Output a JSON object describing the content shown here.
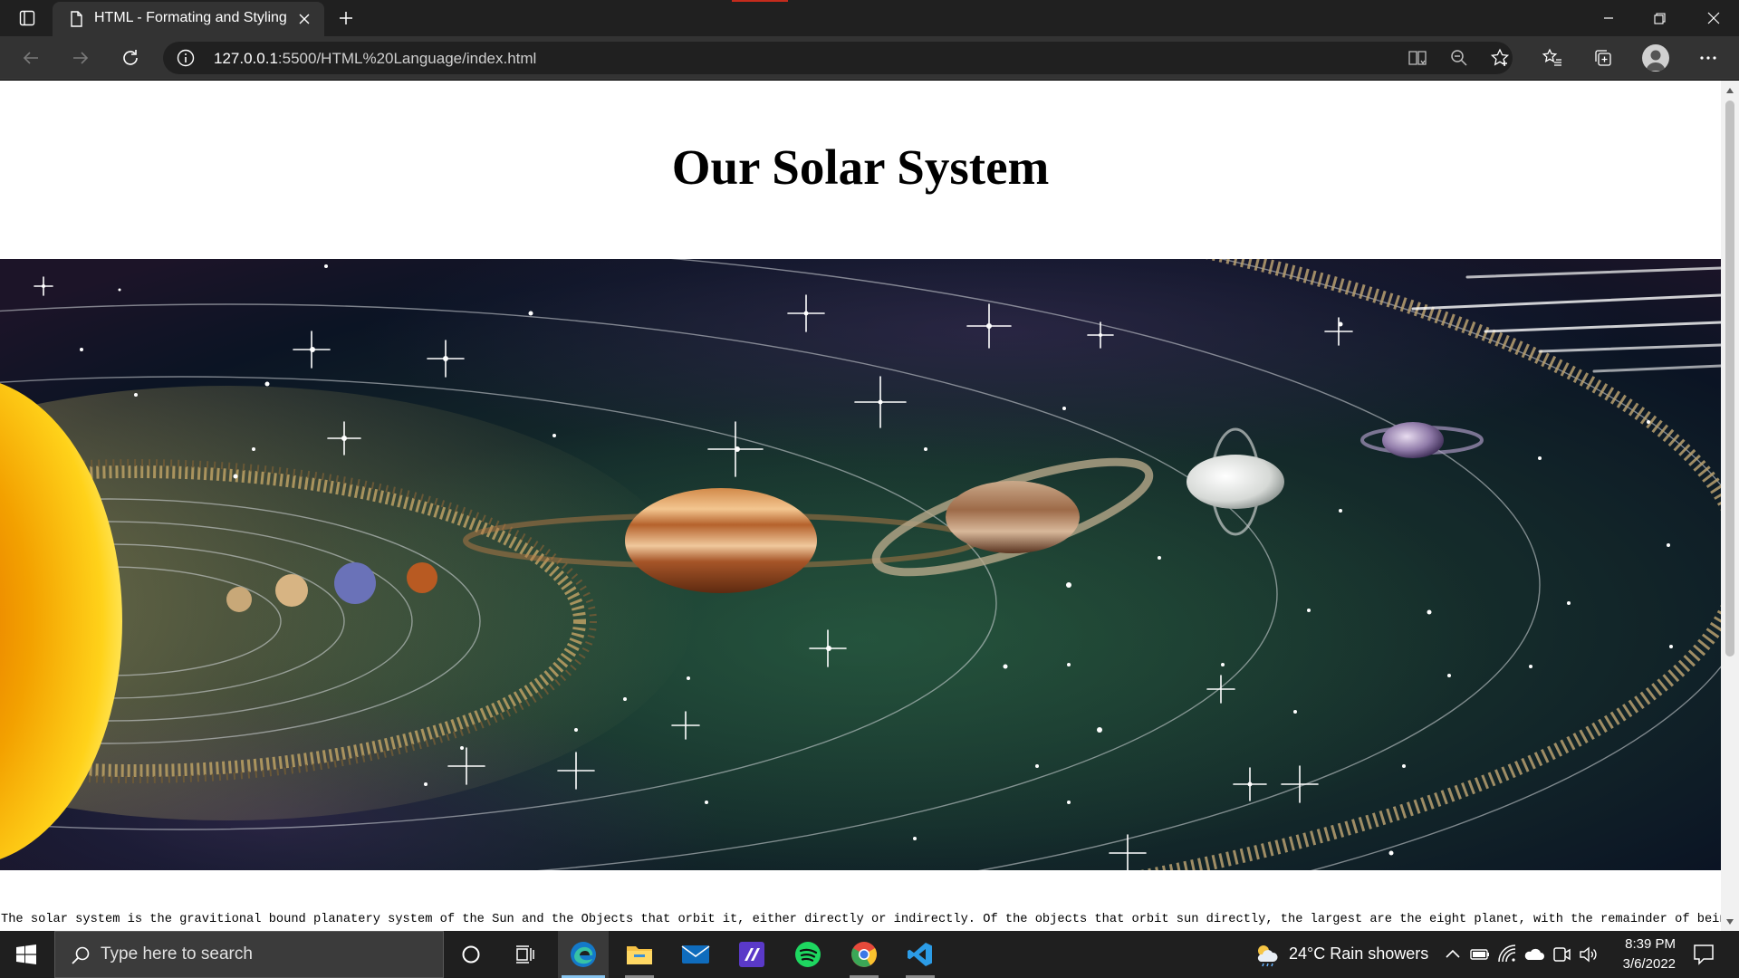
{
  "browser": {
    "tab": {
      "title": "HTML - Formating and Styling"
    },
    "address": {
      "host": "127.0.0.1",
      "path": ":5500/HTML%20Language/index.html"
    },
    "accent_color": "#c42b1c"
  },
  "page": {
    "title": "Our Solar System",
    "image_alt": "Solar system illustration",
    "paragraph": "The solar system is the gravitional bound planatery system of the Sun and the Objects that orbit it, either directly or indirectly. Of the objects that orbit sun directly, the largest are the eight planet, with the remainder of being"
  },
  "taskbar": {
    "search_placeholder": "Type here to search",
    "weather": "24°C  Rain showers",
    "time": "8:39 PM",
    "date": "3/6/2022",
    "apps": [
      "Cortana",
      "Task View",
      "Microsoft Edge",
      "File Explorer",
      "Mail",
      "Visual Studio",
      "Spotify",
      "Google Chrome",
      "Visual Studio Code"
    ]
  }
}
